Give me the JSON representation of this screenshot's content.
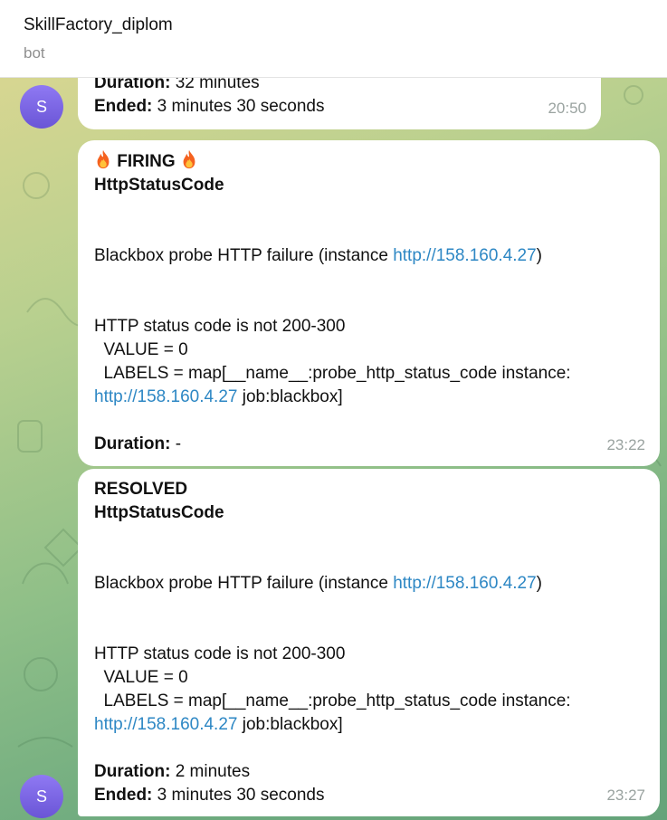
{
  "header": {
    "title": "SkillFactory_diplom",
    "subtitle": "bot"
  },
  "avatar": {
    "letter": "S"
  },
  "messages": [
    {
      "duration_label": "Duration:",
      "duration_value": " 32 minutes",
      "ended_label": "Ended:",
      "ended_value": " 3 minutes 30 seconds",
      "time": "20:50"
    },
    {
      "status": "FIRING",
      "alert_name": "HttpStatusCode",
      "summary_prefix": "Blackbox probe HTTP failure (instance ",
      "summary_link": "http://158.160.4.27",
      "summary_suffix": ")",
      "desc_line1": "HTTP status code is not 200-300",
      "desc_value": "  VALUE = 0",
      "desc_labels": "  LABELS = map[__name__:probe_http_status_code instance:",
      "labels_link": "http://158.160.4.27",
      "labels_suffix": " job:blackbox]",
      "duration_label": "Duration:",
      "duration_value": " -",
      "time": "23:22"
    },
    {
      "status": "RESOLVED",
      "alert_name": "HttpStatusCode",
      "summary_prefix": "Blackbox probe HTTP failure (instance ",
      "summary_link": "http://158.160.4.27",
      "summary_suffix": ")",
      "desc_line1": "HTTP status code is not 200-300",
      "desc_value": "  VALUE = 0",
      "desc_labels": "  LABELS = map[__name__:probe_http_status_code instance:",
      "labels_link": "http://158.160.4.27",
      "labels_suffix": " job:blackbox]",
      "duration_label": "Duration:",
      "duration_value": " 2 minutes",
      "ended_label": "Ended:",
      "ended_value": " 3 minutes 30 seconds",
      "time": "23:27"
    }
  ],
  "colors": {
    "link": "#2d87c4",
    "avatar": "#7b66e6",
    "timestamp": "#9aa3a0"
  },
  "icons": [
    "fire-icon"
  ]
}
